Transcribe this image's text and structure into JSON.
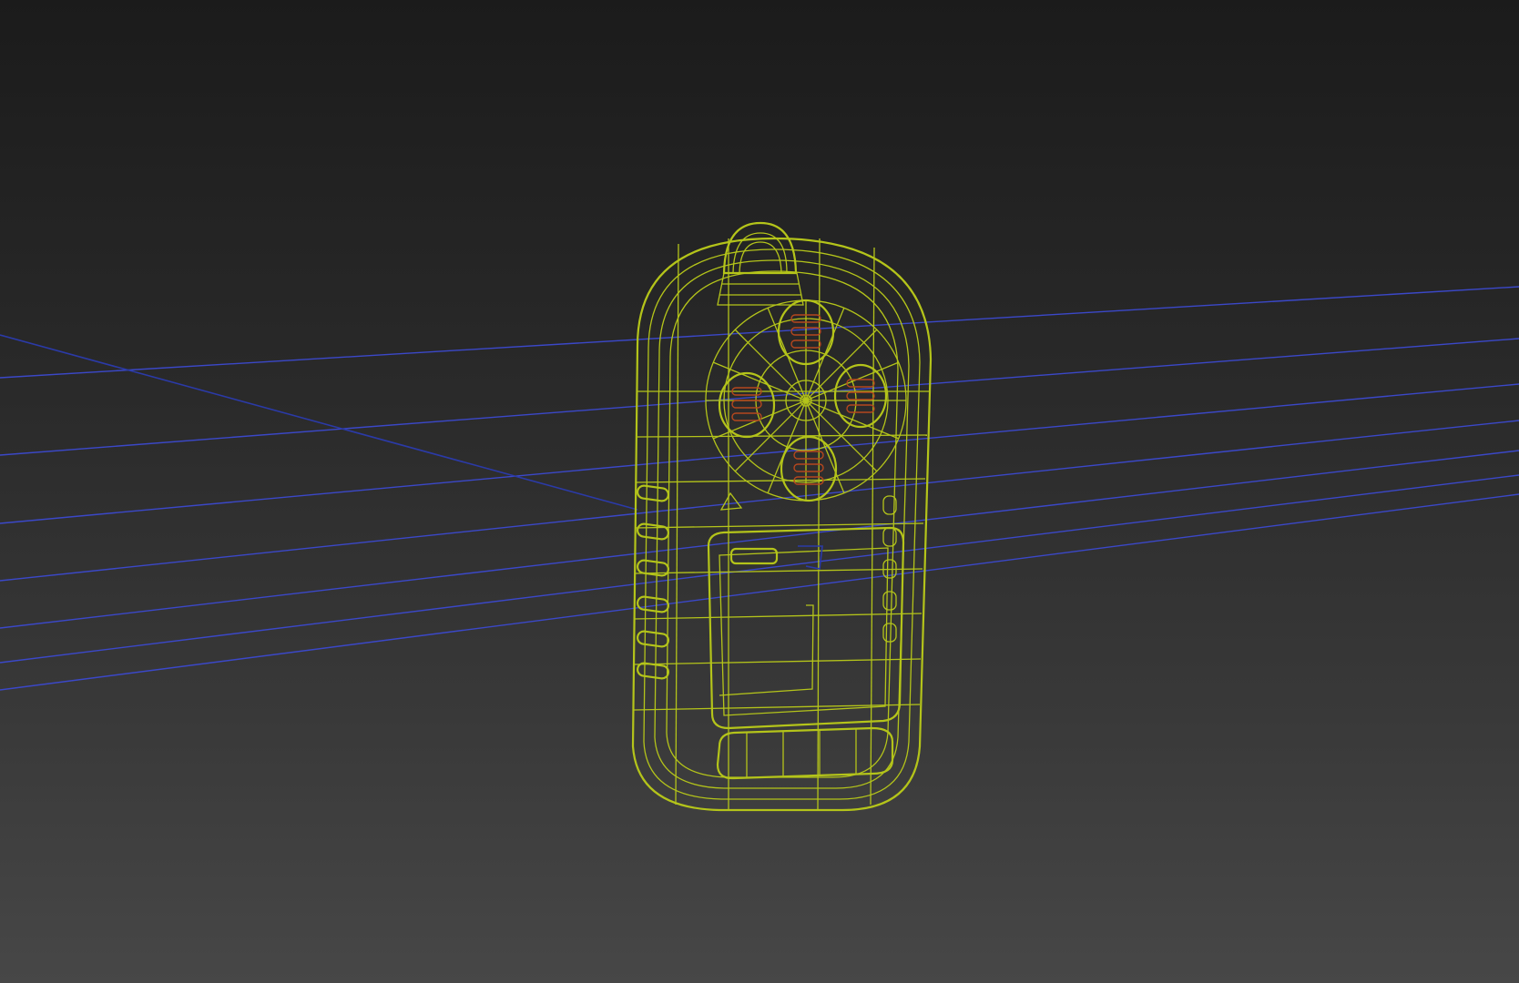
{
  "viewport": {
    "background_top": "#1b1b1b",
    "background_bottom": "#474747"
  },
  "model": {
    "object": "gas-detector-wireframe",
    "wire_color": "#b4c41a",
    "sensor_color": "#b5471e",
    "sensor_count": 4,
    "side_button_count": 6
  },
  "guides": {
    "line_color": "#3b48c9"
  }
}
